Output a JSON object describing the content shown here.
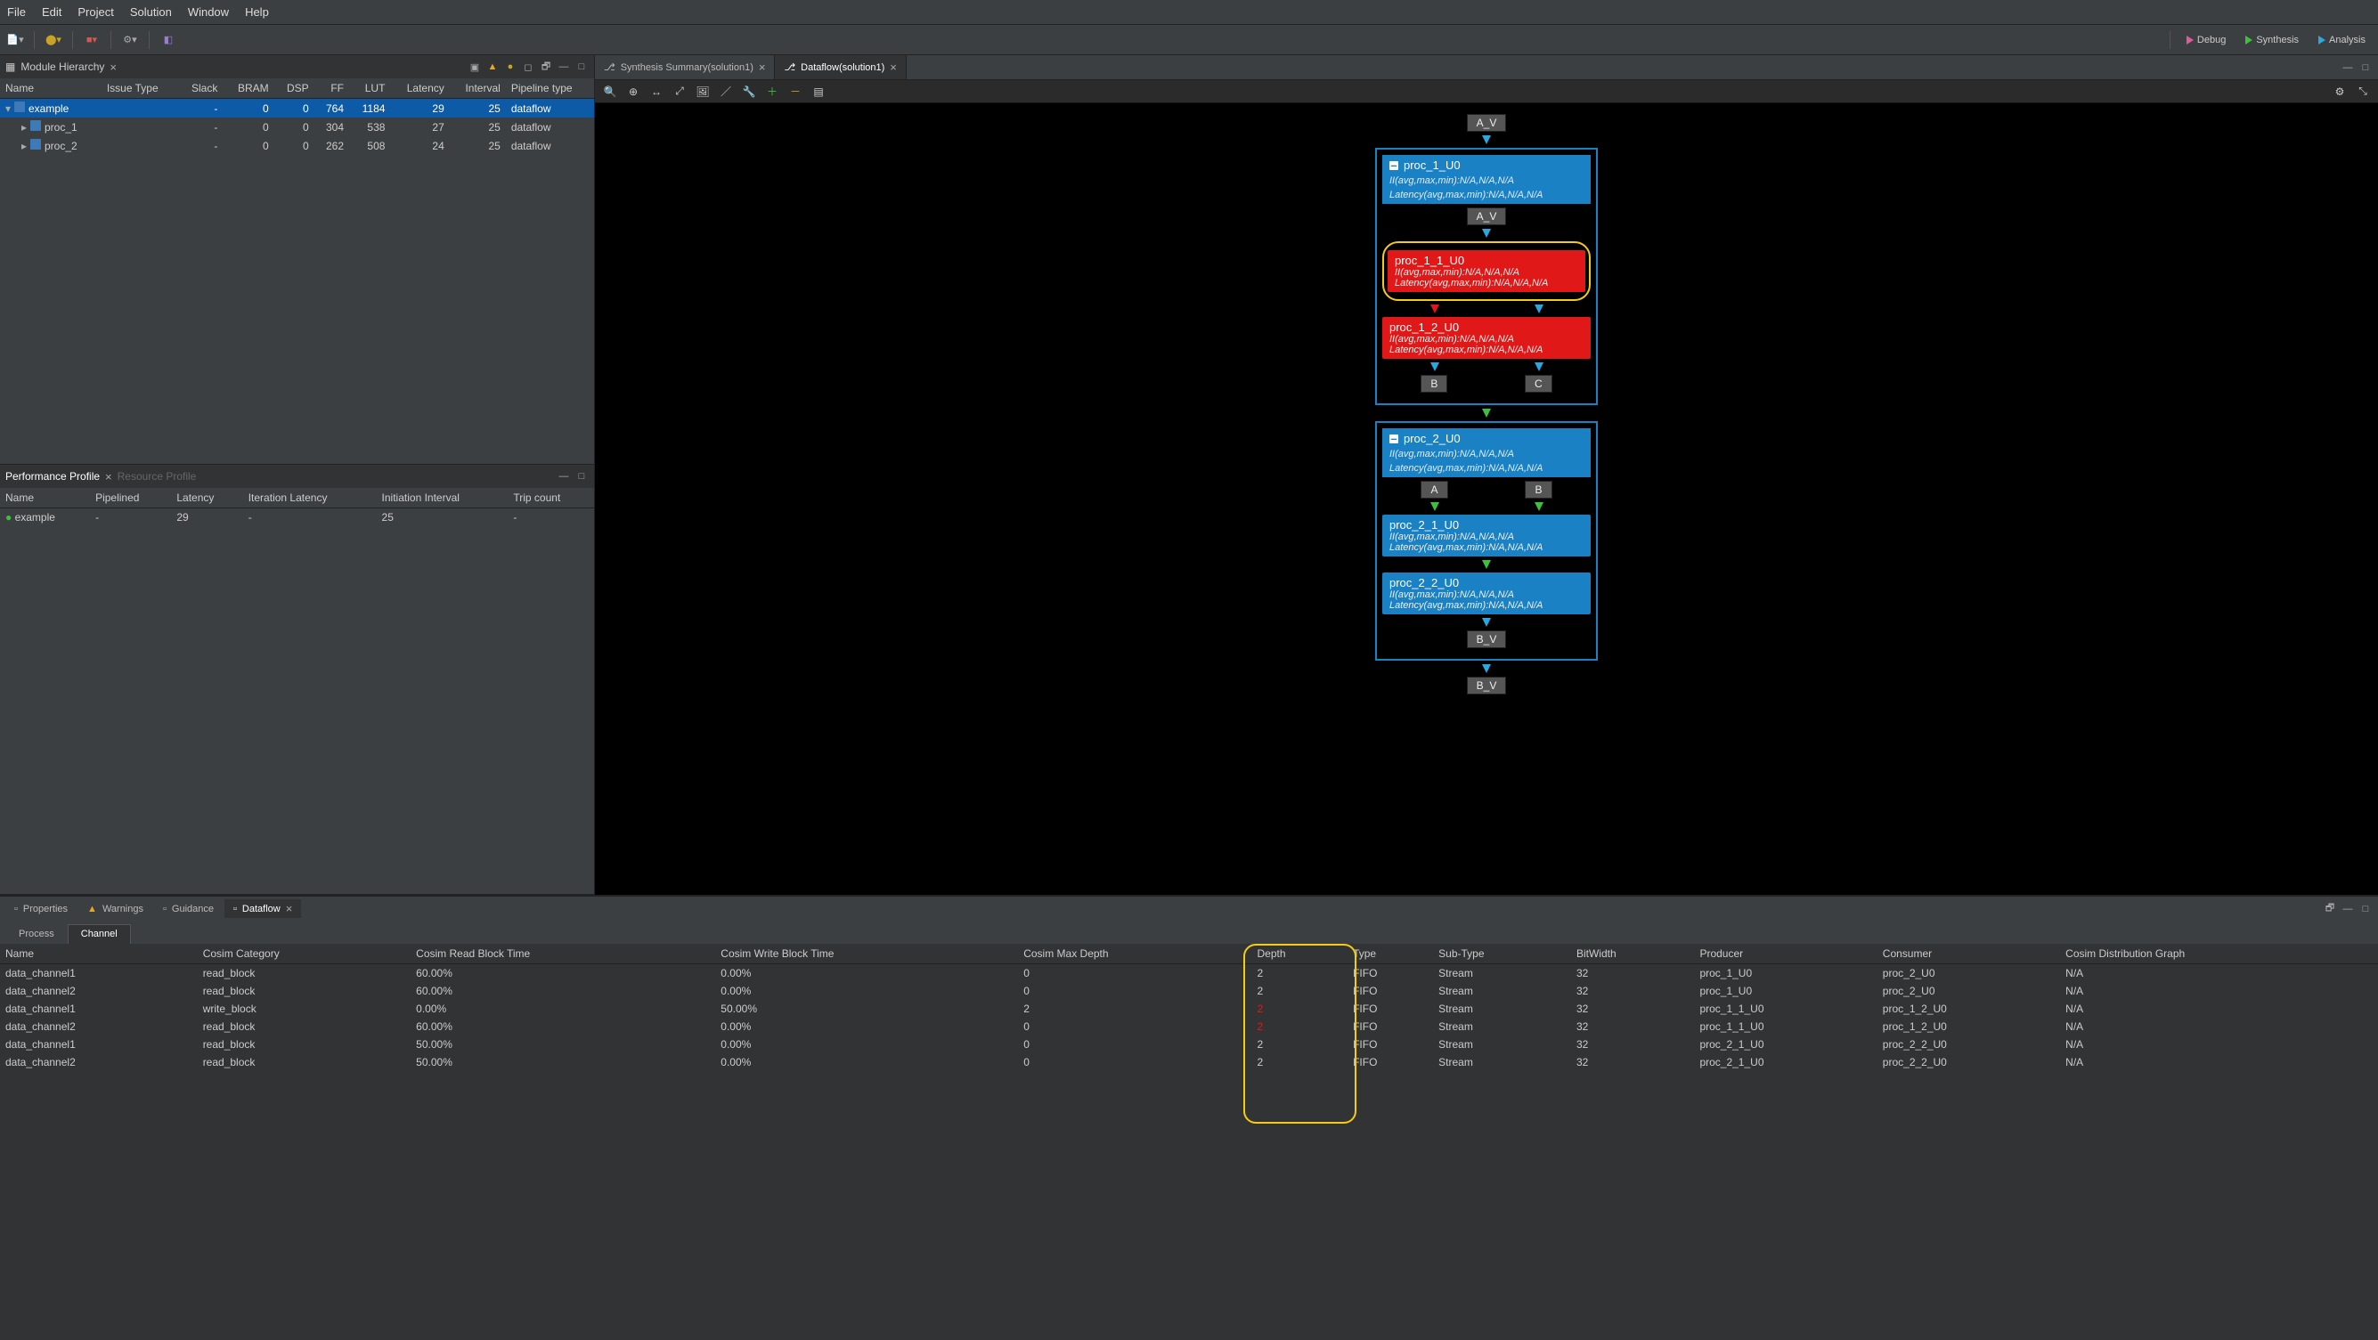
{
  "menu": {
    "items": [
      "File",
      "Edit",
      "Project",
      "Solution",
      "Window",
      "Help"
    ]
  },
  "toolbar_right": [
    {
      "label": "Debug",
      "color": "#e05aa0"
    },
    {
      "label": "Synthesis",
      "color": "#3cc13c"
    },
    {
      "label": "Analysis",
      "color": "#2aa6e0"
    }
  ],
  "module_hierarchy": {
    "title": "Module Hierarchy",
    "columns": [
      "Name",
      "Issue Type",
      "Slack",
      "BRAM",
      "DSP",
      "FF",
      "LUT",
      "Latency",
      "Interval",
      "Pipeline type"
    ],
    "rows": [
      {
        "name": "example",
        "indent": 0,
        "expanded": true,
        "selected": true,
        "vals": [
          "",
          "-",
          "0",
          "0",
          "764",
          "1184",
          "29",
          "25",
          "dataflow"
        ]
      },
      {
        "name": "proc_1",
        "indent": 1,
        "expanded": false,
        "selected": false,
        "vals": [
          "",
          "-",
          "0",
          "0",
          "304",
          "538",
          "27",
          "25",
          "dataflow"
        ]
      },
      {
        "name": "proc_2",
        "indent": 1,
        "expanded": false,
        "selected": false,
        "vals": [
          "",
          "-",
          "0",
          "0",
          "262",
          "508",
          "24",
          "25",
          "dataflow"
        ]
      }
    ]
  },
  "perf_profile": {
    "tabs": [
      {
        "label": "Performance Profile",
        "active": true
      },
      {
        "label": "Resource Profile",
        "active": false
      }
    ],
    "columns": [
      "Name",
      "Pipelined",
      "Latency",
      "Iteration Latency",
      "Initiation Interval",
      "Trip count"
    ],
    "rows": [
      {
        "name": "example",
        "pipelined": "-",
        "latency": "29",
        "iter": "-",
        "ii": "25",
        "trip": "-"
      }
    ]
  },
  "editor_tabs": [
    {
      "label": "Synthesis Summary(solution1)",
      "active": false,
      "closeable": true
    },
    {
      "label": "Dataflow(solution1)",
      "active": true,
      "closeable": true
    }
  ],
  "dataflow": {
    "top_port": "A_V",
    "bottom_port": "B_V",
    "group1": {
      "title": "proc_1_U0",
      "ii": "II(avg,max,min):N/A,N/A,N/A",
      "lat": "Latency(avg,max,min):N/A,N/A,N/A",
      "inner_port_top": "A_V",
      "node1": {
        "title": "proc_1_1_U0",
        "ii": "II(avg,max,min):N/A,N/A,N/A",
        "lat": "Latency(avg,max,min):N/A,N/A,N/A"
      },
      "node2": {
        "title": "proc_1_2_U0",
        "ii": "II(avg,max,min):N/A,N/A,N/A",
        "lat": "Latency(avg,max,min):N/A,N/A,N/A"
      },
      "out_ports": [
        "B",
        "C"
      ]
    },
    "group2": {
      "title": "proc_2_U0",
      "ii": "II(avg,max,min):N/A,N/A,N/A",
      "lat": "Latency(avg,max,min):N/A,N/A,N/A",
      "in_ports": [
        "A",
        "B"
      ],
      "node1": {
        "title": "proc_2_1_U0",
        "ii": "II(avg,max,min):N/A,N/A,N/A",
        "lat": "Latency(avg,max,min):N/A,N/A,N/A"
      },
      "node2": {
        "title": "proc_2_2_U0",
        "ii": "II(avg,max,min):N/A,N/A,N/A",
        "lat": "Latency(avg,max,min):N/A,N/A,N/A"
      },
      "out_port": "B_V"
    }
  },
  "bottom_tabs": [
    {
      "label": "Properties",
      "active": false
    },
    {
      "label": "Warnings",
      "active": false,
      "warn": true
    },
    {
      "label": "Guidance",
      "active": false
    },
    {
      "label": "Dataflow",
      "active": true,
      "closeable": true
    }
  ],
  "subtabs": [
    {
      "label": "Process",
      "active": false
    },
    {
      "label": "Channel",
      "active": true
    }
  ],
  "channel_table": {
    "columns": [
      "Name",
      "Cosim Category",
      "Cosim Read Block Time",
      "Cosim Write Block Time",
      "Cosim Max Depth",
      "Depth",
      "Type",
      "Sub-Type",
      "BitWidth",
      "Producer",
      "Consumer",
      "Cosim Distribution Graph"
    ],
    "rows": [
      {
        "name": "data_channel1",
        "cat": "read_block",
        "rbt": "60.00%",
        "wbt": "0.00%",
        "maxd": "0",
        "depth": "2",
        "depth_red": false,
        "type": "FIFO",
        "sub": "Stream",
        "bw": "32",
        "prod": "proc_1_U0",
        "cons": "proc_2_U0",
        "dist": "N/A"
      },
      {
        "name": "data_channel2",
        "cat": "read_block",
        "rbt": "60.00%",
        "wbt": "0.00%",
        "maxd": "0",
        "depth": "2",
        "depth_red": false,
        "type": "FIFO",
        "sub": "Stream",
        "bw": "32",
        "prod": "proc_1_U0",
        "cons": "proc_2_U0",
        "dist": "N/A"
      },
      {
        "name": "data_channel1",
        "cat": "write_block",
        "rbt": "0.00%",
        "wbt": "50.00%",
        "maxd": "2",
        "depth": "2",
        "depth_red": true,
        "type": "FIFO",
        "sub": "Stream",
        "bw": "32",
        "prod": "proc_1_1_U0",
        "cons": "proc_1_2_U0",
        "dist": "N/A"
      },
      {
        "name": "data_channel2",
        "cat": "read_block",
        "rbt": "60.00%",
        "wbt": "0.00%",
        "maxd": "0",
        "depth": "2",
        "depth_red": true,
        "type": "FIFO",
        "sub": "Stream",
        "bw": "32",
        "prod": "proc_1_1_U0",
        "cons": "proc_1_2_U0",
        "dist": "N/A"
      },
      {
        "name": "data_channel1",
        "cat": "read_block",
        "rbt": "50.00%",
        "wbt": "0.00%",
        "maxd": "0",
        "depth": "2",
        "depth_red": false,
        "type": "FIFO",
        "sub": "Stream",
        "bw": "32",
        "prod": "proc_2_1_U0",
        "cons": "proc_2_2_U0",
        "dist": "N/A"
      },
      {
        "name": "data_channel2",
        "cat": "read_block",
        "rbt": "50.00%",
        "wbt": "0.00%",
        "maxd": "0",
        "depth": "2",
        "depth_red": false,
        "type": "FIFO",
        "sub": "Stream",
        "bw": "32",
        "prod": "proc_2_1_U0",
        "cons": "proc_2_2_U0",
        "dist": "N/A"
      }
    ],
    "depth_col_index": 5
  }
}
